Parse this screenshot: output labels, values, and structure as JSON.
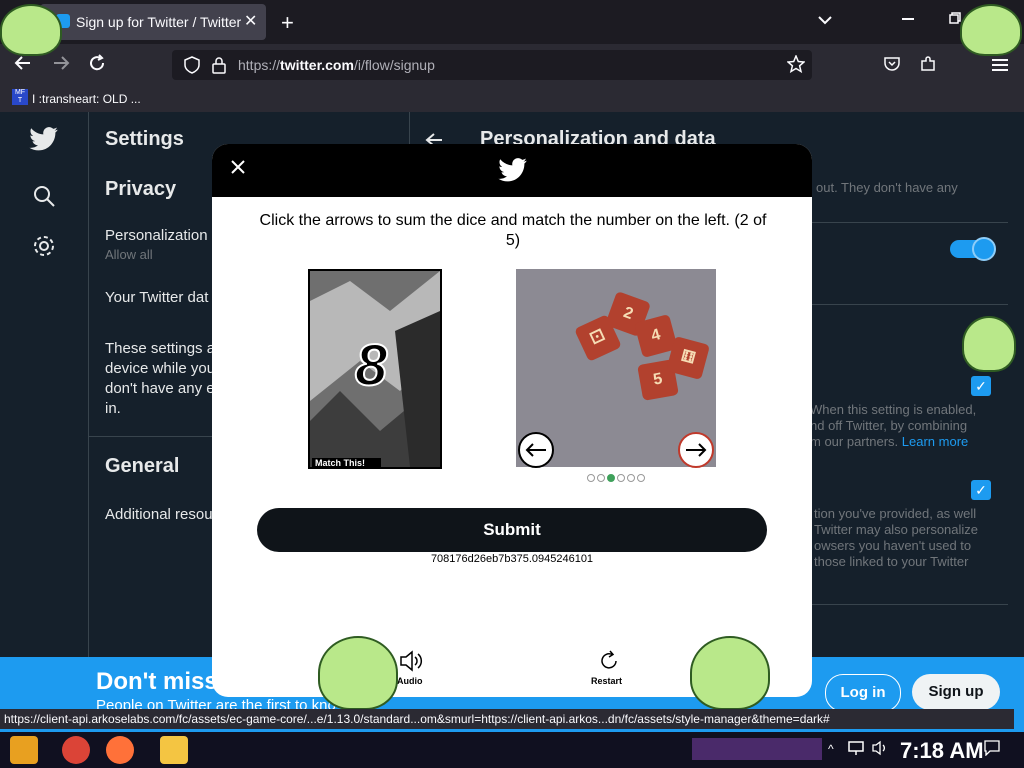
{
  "browser": {
    "tab_title": "Sign up for Twitter / Twitter",
    "tab_close": "✕",
    "new_tab": "+",
    "url_prefix": "https://",
    "url_domain": "twitter.com",
    "url_path": "/i/flow/signup",
    "bookmark_label": "I :transheart: OLD ...",
    "bookmark_favicon": "MF T",
    "status_url": "https://client-api.arkoselabs.com/fc/assets/ec-game-core/...e/1.13.0/standard...om&smurl=https://client-api.arkos...dn/fc/assets/style-manager&theme=dark#"
  },
  "twitter": {
    "settings_title": "Settings",
    "privacy_heading": "Privacy",
    "personalization_label": "Personalization",
    "personalization_sub": "Allow all",
    "your_data_label": "Your Twitter dat",
    "settings_desc_1": "These settings a",
    "settings_desc_2": "device while you",
    "settings_desc_3": "don't have any e",
    "settings_desc_4": "in.",
    "general_heading": "General",
    "additional_label": "Additional resou",
    "detail_title": "Personalization and data",
    "detail_line_1": "out. They don't have any",
    "detail_line_2": "When this setting is enabled,",
    "detail_line_3": "nd off Twitter, by combining",
    "detail_line_4a": "m our partners.",
    "detail_line_4b": "Learn more",
    "detail_line_5": "tion you've provided, as well",
    "detail_line_6": "Twitter may also personalize",
    "detail_line_7": "owsers you haven't used to",
    "detail_line_8": "those linked to your Twitter",
    "banner_title": "Don't miss",
    "banner_sub": "People on Twitter are the first to kno",
    "login_label": "Log in",
    "signup_label": "Sign up"
  },
  "captcha": {
    "instruction": "Click the arrows to sum the dice and match the number on the left. (2 of 5)",
    "target_number": "8",
    "target_caption": "Match This!",
    "dice_values": [
      "2",
      "4",
      "5",
      "6"
    ],
    "dots_total": 6,
    "dots_active": 3,
    "submit_label": "Submit",
    "session_id": "708176d26eb7b375.0945246101",
    "audio_label": "Audio",
    "restart_label": "Restart"
  },
  "taskbar": {
    "clock": "7:18 AM"
  },
  "colors": {
    "twitter_blue": "#1d9bf0",
    "page_bg": "#15202b",
    "modal_header": "#000000"
  },
  "icons": [
    "twitter-bird-icon",
    "search-icon",
    "gear-icon",
    "back-arrow-icon",
    "close-icon",
    "lock-icon",
    "shield-icon",
    "star-icon",
    "pocket-icon",
    "extensions-icon",
    "menu-icon",
    "audio-icon",
    "restart-icon",
    "left-arrow-icon",
    "right-arrow-icon"
  ]
}
